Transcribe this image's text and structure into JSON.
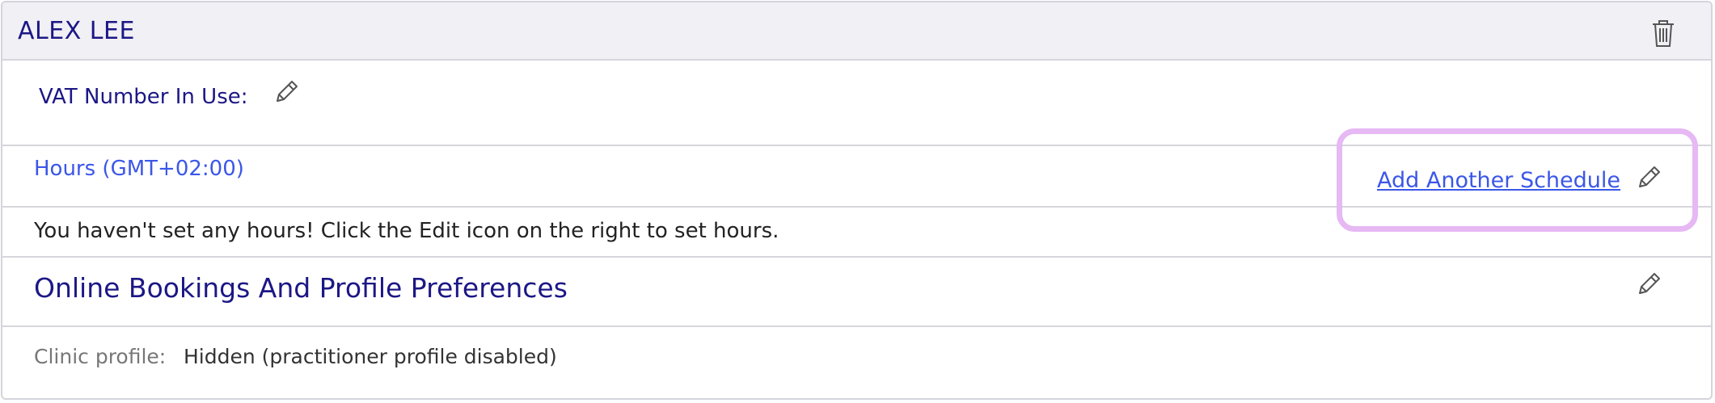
{
  "header": {
    "name": "ALEX LEE",
    "delete_icon": "trash-icon"
  },
  "vat": {
    "label": "VAT Number In Use:",
    "edit_icon": "pencil-icon"
  },
  "hours": {
    "label": "Hours (GMT+02:00)",
    "add_schedule_label": "Add Another Schedule",
    "edit_icon": "pencil-icon",
    "empty_message": "You haven't set any hours! Click the Edit icon on the right to set hours."
  },
  "preferences": {
    "title": "Online Bookings And Profile Preferences",
    "edit_icon": "pencil-icon",
    "clinic_profile_label": "Clinic profile:",
    "clinic_profile_value": "Hidden (practitioner profile disabled)"
  },
  "colors": {
    "heading": "#1c1785",
    "link": "#3b57e8",
    "highlight": "#e6b8f4",
    "header_bg": "#f0f0f5"
  }
}
